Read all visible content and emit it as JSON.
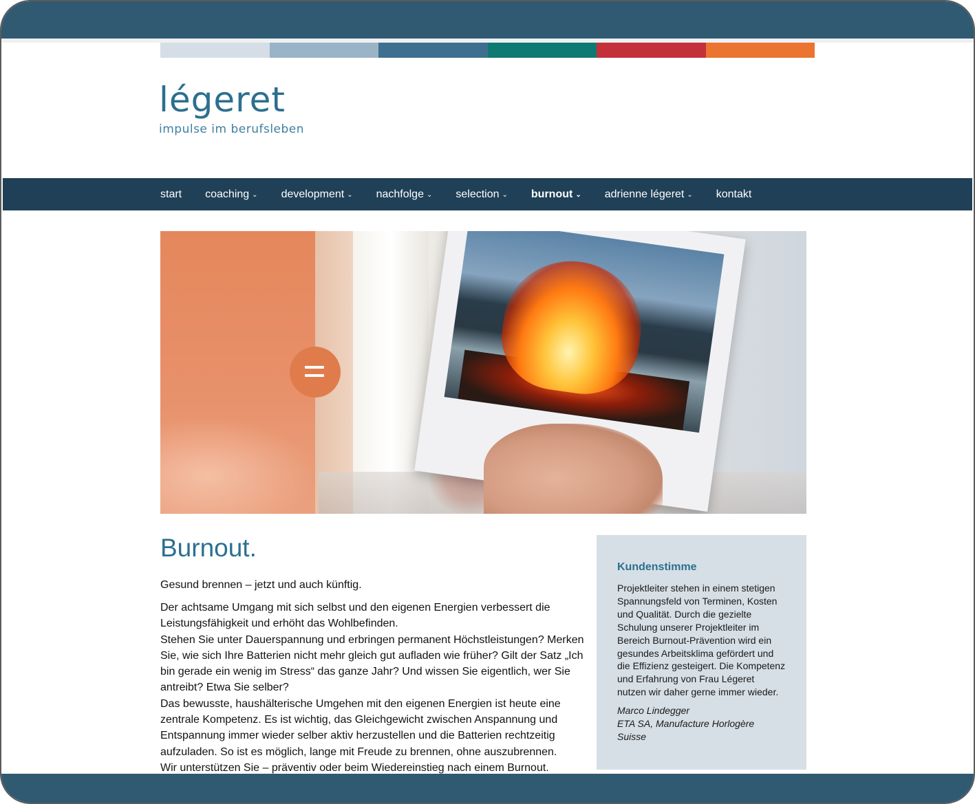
{
  "brand": {
    "name": "légeret",
    "tagline": "impulse im berufsleben",
    "accent": "#2c6f8f",
    "colorbar": [
      "#d5dee6",
      "#9ab3c6",
      "#3f6f8e",
      "#0e7a73",
      "#c3303a",
      "#ea7430"
    ]
  },
  "nav": {
    "items": [
      {
        "label": "start"
      },
      {
        "label": "coaching"
      },
      {
        "label": "development"
      },
      {
        "label": "nachfolge"
      },
      {
        "label": "selection"
      },
      {
        "label": "burnout"
      },
      {
        "label": "adrienne légeret"
      },
      {
        "label": "kontakt"
      }
    ],
    "active": "burnout"
  },
  "main": {
    "title": "Burnout.",
    "lead": "Gesund brennen – jetzt und auch künftig.",
    "paragraphs": [
      "Der achtsame Umgang mit sich selbst und den eigenen Energien verbessert die Leistungsfähigkeit und erhöht das Wohlbefinden.",
      "Stehen Sie unter Dauerspannung und erbringen permanent Höchstleistungen? Merken Sie, wie sich Ihre Batterien nicht mehr gleich gut aufladen wie früher? Gilt der Satz „Ich bin gerade ein wenig im Stress“ das ganze Jahr? Und wissen Sie eigentlich, wer Sie antreibt? Etwa Sie selber?",
      "Das bewusste, haushälterische Umgehen mit den eigenen Energien ist heute eine zentrale Kompetenz. Es ist wichtig, das Gleichgewicht zwischen Anspannung und Entspannung immer wieder selber aktiv herzustellen und die Batterien rechtzeitig aufzuladen. So ist es möglich, lange mit Freude zu brennen, ohne auszubrennen.",
      "Wir unterstützen Sie – präventiv oder beim Wiedereinstieg nach einem Burnout."
    ]
  },
  "testimonial": {
    "heading": "Kundenstimme",
    "quote": "Projektleiter stehen in einem stetigen Spannungsfeld von Terminen, Kosten und Qualität. Durch die gezielte Schulung unserer Projektleiter im Bereich Burnout-Prävention wird ein gesundes Arbeitsklima gefördert und die Effizienz gesteigert. Die Kompetenz und Erfahrung von Frau Légeret nutzen wir daher gerne immer wieder.",
    "author_name": "Marco Lindegger",
    "author_company": "ETA SA, Manufacture Horlogère Suisse"
  },
  "icons": {
    "nav_dropdown": "chevron-down-icon",
    "hero_badge": "equals-icon"
  }
}
